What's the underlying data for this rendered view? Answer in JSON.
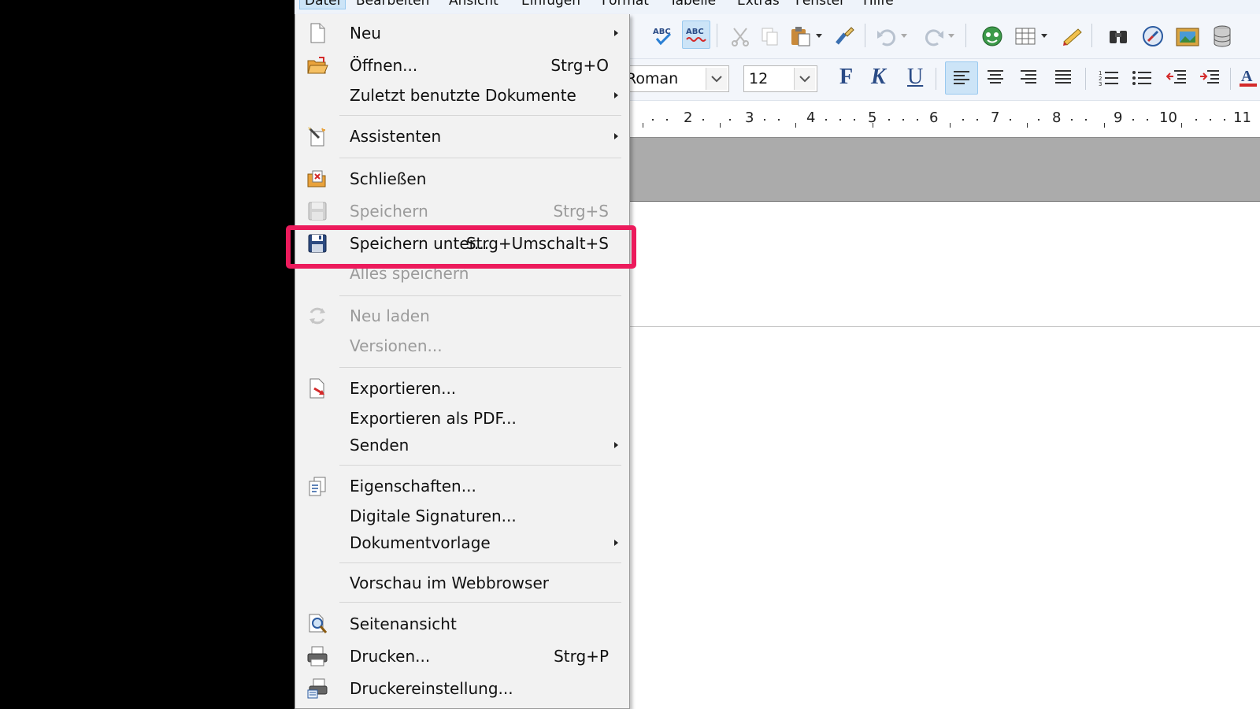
{
  "menubar": {
    "items": [
      "Datei",
      "Bearbeiten",
      "Ansicht",
      "Einfügen",
      "Format",
      "Tabelle",
      "Extras",
      "Fenster",
      "Hilfe"
    ]
  },
  "toolbar": {
    "font_name": "Roman",
    "font_size": "12",
    "bold": "F",
    "italic": "K",
    "underline": "U",
    "icons": [
      "spellcheck-icon",
      "autospellcheck-icon",
      "cut-icon",
      "copy-icon",
      "paste-icon",
      "clone-format-icon",
      "undo-icon",
      "redo-icon",
      "navigator-icon",
      "table-icon",
      "draw-icon",
      "find-icon",
      "gallery-icon",
      "image-icon",
      "database-icon"
    ]
  },
  "ruler": {
    "numbers": [
      "2",
      "3",
      "4",
      "5",
      "6",
      "7",
      "8",
      "9",
      "10",
      "11"
    ]
  },
  "file_menu": {
    "items": [
      {
        "label": "Neu",
        "shortcut": "",
        "submenu": true,
        "disabled": false,
        "icon": "new-document-icon"
      },
      {
        "label": "Öffnen...",
        "shortcut": "Strg+O",
        "submenu": false,
        "disabled": false,
        "icon": "open-folder-icon"
      },
      {
        "label": "Zuletzt benutzte Dokumente",
        "shortcut": "",
        "submenu": true,
        "disabled": false,
        "icon": ""
      },
      {
        "label": "Assistenten",
        "shortcut": "",
        "submenu": true,
        "disabled": false,
        "icon": "wizard-icon"
      },
      {
        "label": "Schließen",
        "shortcut": "",
        "submenu": false,
        "disabled": false,
        "icon": "close-document-icon"
      },
      {
        "label": "Speichern",
        "shortcut": "Strg+S",
        "submenu": false,
        "disabled": true,
        "icon": "save-icon"
      },
      {
        "label": "Speichern unter...",
        "shortcut": "Strg+Umschalt+S",
        "submenu": false,
        "disabled": false,
        "icon": "save-as-icon"
      },
      {
        "label": "Alles speichern",
        "shortcut": "",
        "submenu": false,
        "disabled": true,
        "icon": ""
      },
      {
        "label": "Neu laden",
        "shortcut": "",
        "submenu": false,
        "disabled": true,
        "icon": "reload-icon"
      },
      {
        "label": "Versionen...",
        "shortcut": "",
        "submenu": false,
        "disabled": true,
        "icon": ""
      },
      {
        "label": "Exportieren...",
        "shortcut": "",
        "submenu": false,
        "disabled": false,
        "icon": "export-icon"
      },
      {
        "label": "Exportieren als PDF...",
        "shortcut": "",
        "submenu": false,
        "disabled": false,
        "icon": ""
      },
      {
        "label": "Senden",
        "shortcut": "",
        "submenu": true,
        "disabled": false,
        "icon": ""
      },
      {
        "label": "Eigenschaften...",
        "shortcut": "",
        "submenu": false,
        "disabled": false,
        "icon": "properties-icon"
      },
      {
        "label": "Digitale Signaturen...",
        "shortcut": "",
        "submenu": false,
        "disabled": false,
        "icon": ""
      },
      {
        "label": "Dokumentvorlage",
        "shortcut": "",
        "submenu": true,
        "disabled": false,
        "icon": ""
      },
      {
        "label": "Vorschau im Webbrowser",
        "shortcut": "",
        "submenu": false,
        "disabled": false,
        "icon": ""
      },
      {
        "label": "Seitenansicht",
        "shortcut": "",
        "submenu": false,
        "disabled": false,
        "icon": "page-preview-icon"
      },
      {
        "label": "Drucken...",
        "shortcut": "Strg+P",
        "submenu": false,
        "disabled": false,
        "icon": "print-icon"
      },
      {
        "label": "Druckereinstellung...",
        "shortcut": "",
        "submenu": false,
        "disabled": false,
        "icon": "printer-settings-icon"
      }
    ]
  },
  "colors": {
    "highlight": "#ec1b5c",
    "menu_bg": "#f2f2f2",
    "toolbar_bg": "#f3f6fb"
  }
}
